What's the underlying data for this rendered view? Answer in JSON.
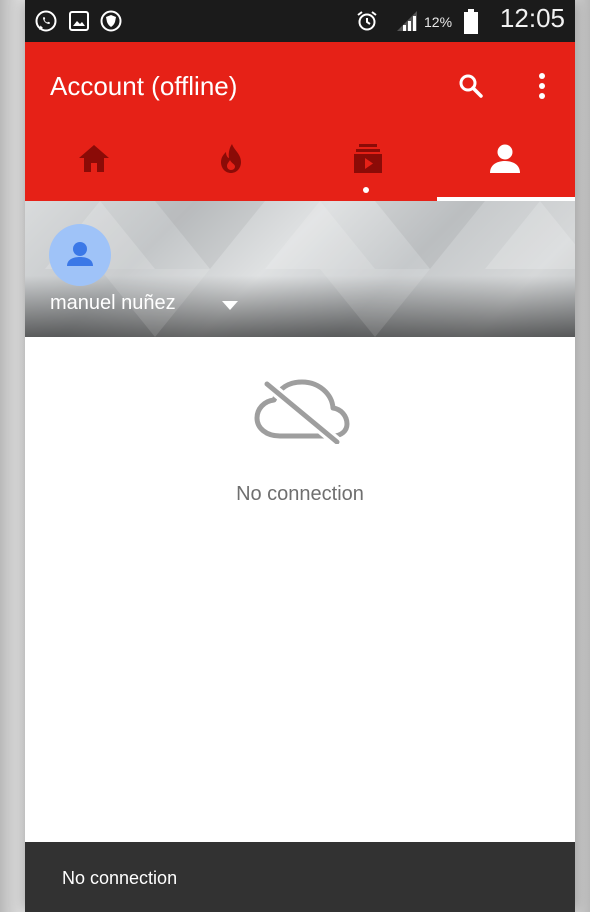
{
  "status_bar": {
    "icons": [
      "whatsapp-icon",
      "gallery-icon",
      "shield-icon",
      "alarm-icon",
      "signal-icon",
      "battery-icon"
    ],
    "battery": "12%",
    "time": "12:05"
  },
  "app_bar": {
    "title": "Account (offline)",
    "actions": [
      "search-icon",
      "more-vert-icon"
    ]
  },
  "tabs": [
    {
      "icon": "home-icon",
      "selected": false
    },
    {
      "icon": "trending-icon",
      "selected": false
    },
    {
      "icon": "subscriptions-icon",
      "selected": false,
      "has_new": true
    },
    {
      "icon": "account-icon",
      "selected": true
    }
  ],
  "account": {
    "name": "manuel nuñez"
  },
  "content": {
    "icon": "cloud-off-icon",
    "message": "No connection"
  },
  "snackbar": {
    "message": "No connection"
  },
  "colors": {
    "app_bar": "#e62117",
    "tab_inactive": "#8b0b07",
    "status_bar": "#1b1b1b",
    "snackbar": "#323232",
    "avatar_bg": "#9fc3f8",
    "avatar_fg": "#3b78e7"
  }
}
